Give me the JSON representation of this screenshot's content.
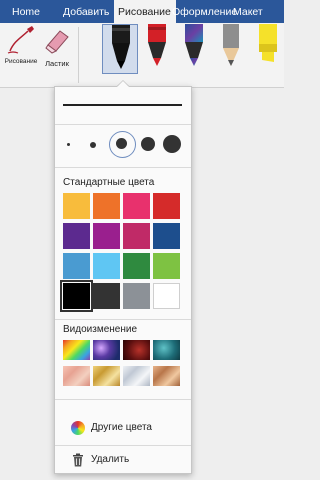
{
  "ribbon": {
    "tabs": [
      {
        "label": "Home",
        "active": false
      },
      {
        "label": "Добавить",
        "active": false
      },
      {
        "label": "Рисование",
        "active": true
      },
      {
        "label": "Оформление",
        "active": false
      },
      {
        "label": "Макет",
        "active": false
      }
    ],
    "tools": {
      "draw_label": "Рисование",
      "eraser_label": "Ластик"
    },
    "pens": [
      {
        "icon": "pen-icon",
        "color": "#111111",
        "selected": true
      },
      {
        "icon": "pen-icon",
        "color": "#d32027",
        "selected": false
      },
      {
        "icon": "pen-icon",
        "color": "#3a6fb0",
        "selected": false
      },
      {
        "icon": "pencil-icon",
        "color": "#8e8e8e",
        "selected": false
      },
      {
        "icon": "highlighter-icon",
        "color": "#f5e12a",
        "selected": false
      }
    ]
  },
  "popup": {
    "standard_colors_title": "Стандартные цвета",
    "standard_colors": [
      "#f8bc3c",
      "#ee7229",
      "#e8316d",
      "#d52b2a",
      "#5c2a8f",
      "#9a1f8e",
      "#c02a67",
      "#1d4e8d",
      "#4a9bd1",
      "#5fc6f3",
      "#2f8a3f",
      "#7ec242",
      "#000000",
      "#333333",
      "#8c9197",
      "#ffffff"
    ],
    "selected_color_index": 12,
    "textures_title": "Видоизменение",
    "textures": [
      "rainbow",
      "galaxy",
      "lava",
      "ocean",
      "rose-gold",
      "gold",
      "silver",
      "bronze"
    ],
    "more_colors_label": "Другие цвета",
    "delete_label": "Удалить"
  }
}
